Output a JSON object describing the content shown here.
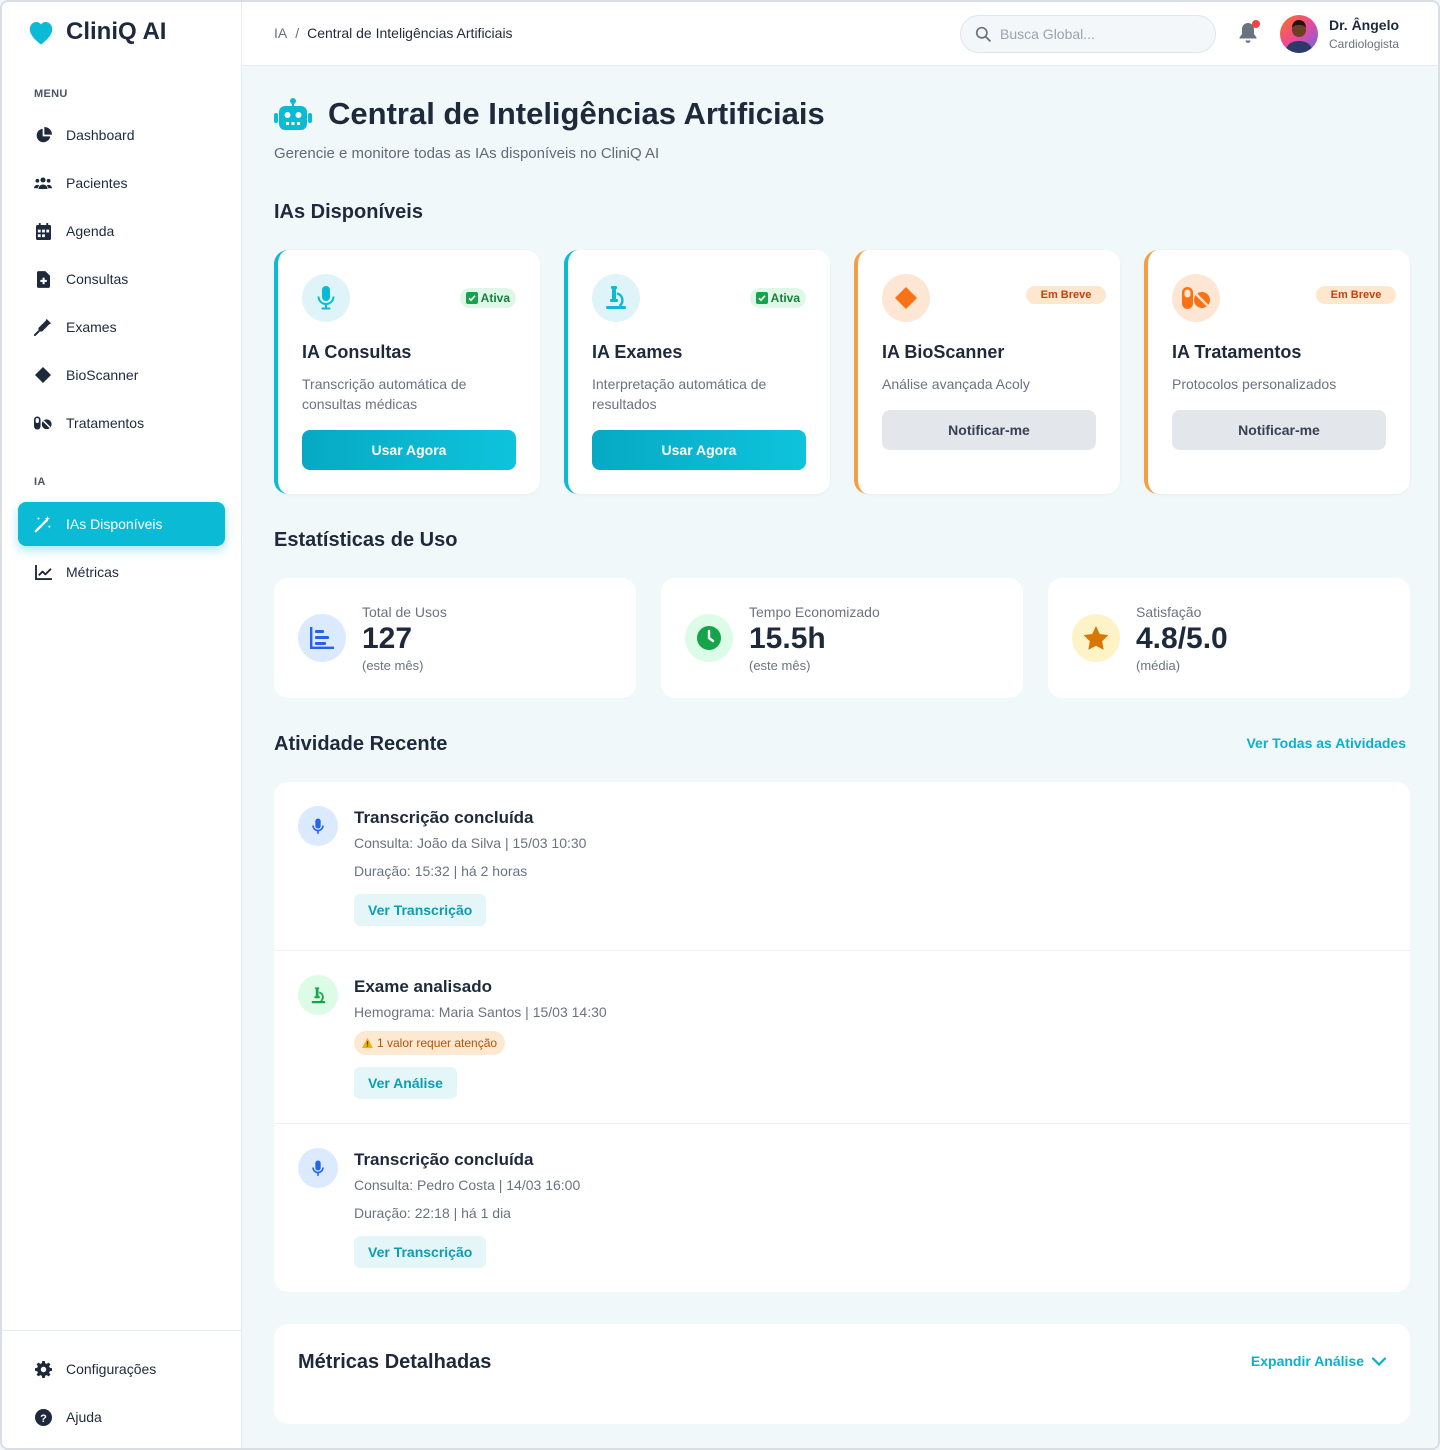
{
  "app": {
    "name": "CliniQ AI"
  },
  "sidebar": {
    "menu_label": "MENU",
    "items": [
      {
        "label": "Dashboard",
        "icon": "pie-chart-icon"
      },
      {
        "label": "Pacientes",
        "icon": "users-icon"
      },
      {
        "label": "Agenda",
        "icon": "calendar-icon"
      },
      {
        "label": "Consultas",
        "icon": "file-medical-icon"
      },
      {
        "label": "Exames",
        "icon": "syringe-icon"
      },
      {
        "label": "BioScanner",
        "icon": "diamond-icon"
      },
      {
        "label": "Tratamentos",
        "icon": "pills-icon"
      }
    ],
    "ia_label": "IA",
    "ia_items": [
      {
        "label": "IAs Disponíveis",
        "icon": "magic-wand-icon",
        "active": true
      },
      {
        "label": "Métricas",
        "icon": "line-chart-icon"
      }
    ],
    "bottom_items": [
      {
        "label": "Configurações",
        "icon": "gear-icon"
      },
      {
        "label": "Ajuda",
        "icon": "help-icon"
      }
    ]
  },
  "topbar": {
    "breadcrumb": [
      "IA",
      "Central de Inteligências Artificiais"
    ],
    "search_placeholder": "Busca Global...",
    "user_name": "Dr. Ângelo",
    "user_role": "Cardiologista"
  },
  "page": {
    "title": "Central de Inteligências Artificiais",
    "subtitle": "Gerencie e monitore todas as IAs disponíveis no CliniQ AI"
  },
  "ias_section": {
    "title": "IAs Disponíveis",
    "cards": [
      {
        "name": "IA Consultas",
        "desc": "Transcrição automática de consultas médicas",
        "badge": "Ativa",
        "button": "Usar Agora",
        "icon": "microphone-icon"
      },
      {
        "name": "IA Exames",
        "desc": "Interpretação automática de resultados",
        "badge": "Ativa",
        "button": "Usar Agora",
        "icon": "microscope-icon"
      },
      {
        "name": "IA BioScanner",
        "desc": "Análise avançada Acoly",
        "badge": "Em Breve",
        "button": "Notificar-me",
        "icon": "diamond-icon"
      },
      {
        "name": "IA Tratamentos",
        "desc": "Protocolos personalizados",
        "badge": "Em Breve",
        "button": "Notificar-me",
        "icon": "pills-icon"
      }
    ]
  },
  "stats_section": {
    "title": "Estatísticas de Uso",
    "cards": [
      {
        "label": "Total de Usos",
        "value": "127",
        "note": "(este mês)",
        "icon": "bar-list-icon"
      },
      {
        "label": "Tempo Economizado",
        "value": "15.5h",
        "note": "(este mês)",
        "icon": "clock-icon"
      },
      {
        "label": "Satisfação",
        "value": "4.8/5.0",
        "note": "(média)",
        "icon": "star-icon"
      }
    ]
  },
  "activity_section": {
    "title": "Atividade Recente",
    "see_all": "Ver Todas as Atividades",
    "items": [
      {
        "title": "Transcrição concluída",
        "line1": "Consulta: João da Silva | 15/03 10:30",
        "line2": "Duração: 15:32 | há 2 horas",
        "button": "Ver Transcrição"
      },
      {
        "title": "Exame analisado",
        "line1": "Hemograma: Maria Santos | 15/03 14:30",
        "warning": "1 valor requer atenção",
        "button": "Ver Análise"
      },
      {
        "title": "Transcrição concluída",
        "line1": "Consulta: Pedro Costa | 14/03 16:00",
        "line2": "Duração: 22:18 | há 1 dia",
        "button": "Ver Transcrição"
      }
    ]
  },
  "metrics_section": {
    "title": "Métricas Detalhadas",
    "expand": "Expandir Análise"
  },
  "colors": {
    "accent": "#0bbad4",
    "orange": "#f59e42",
    "text": "#1e2a3b",
    "muted": "#6b7280",
    "bg": "#f1f8fa"
  }
}
